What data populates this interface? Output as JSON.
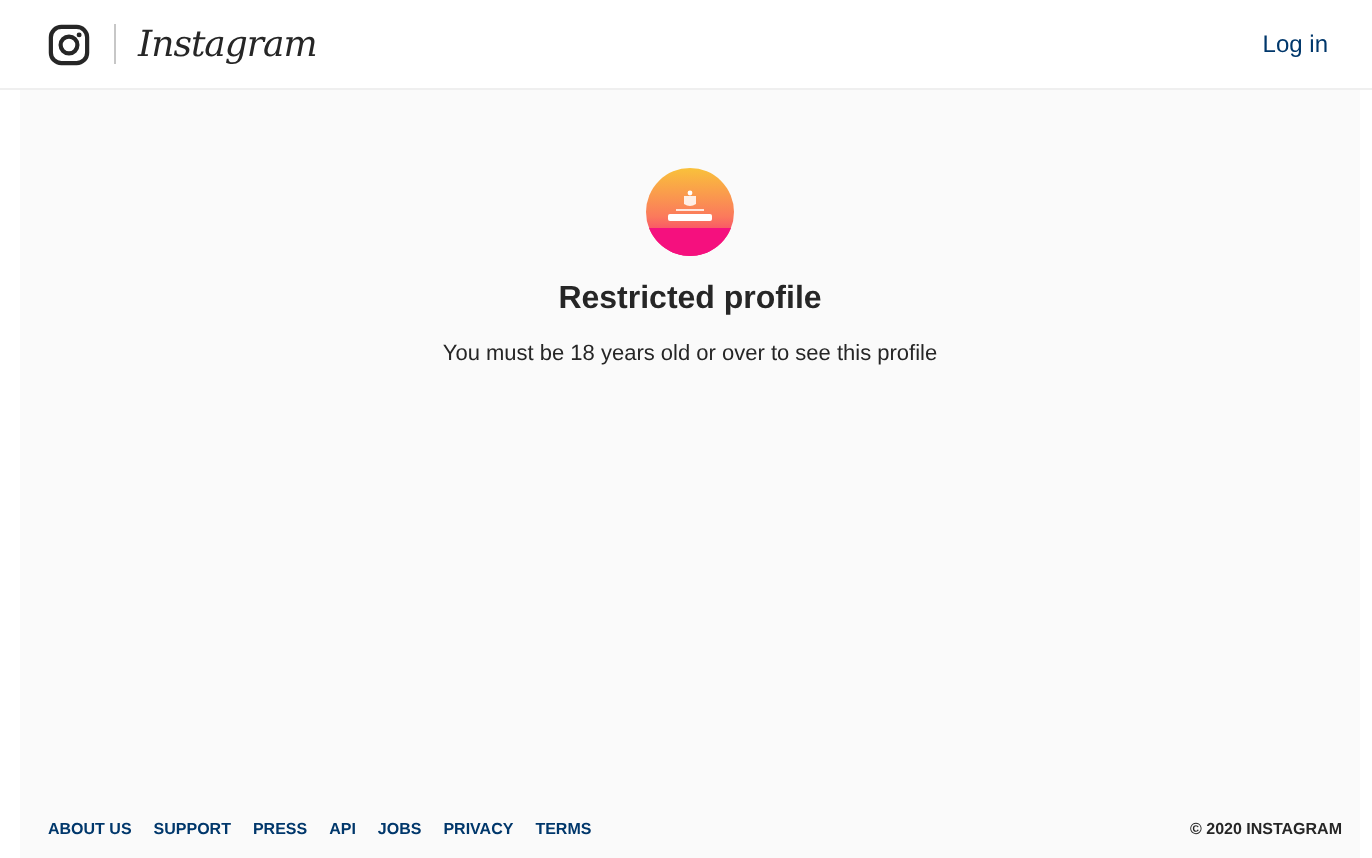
{
  "header": {
    "logo_text": "Instagram",
    "login_link": "Log in"
  },
  "profile": {
    "title": "Restricted profile",
    "message": "You must be 18 years old or over to see this profile"
  },
  "footer": {
    "links": [
      "ABOUT US",
      "SUPPORT",
      "PRESS",
      "API",
      "JOBS",
      "PRIVACY",
      "TERMS"
    ],
    "copyright": "© 2020 INSTAGRAM"
  }
}
